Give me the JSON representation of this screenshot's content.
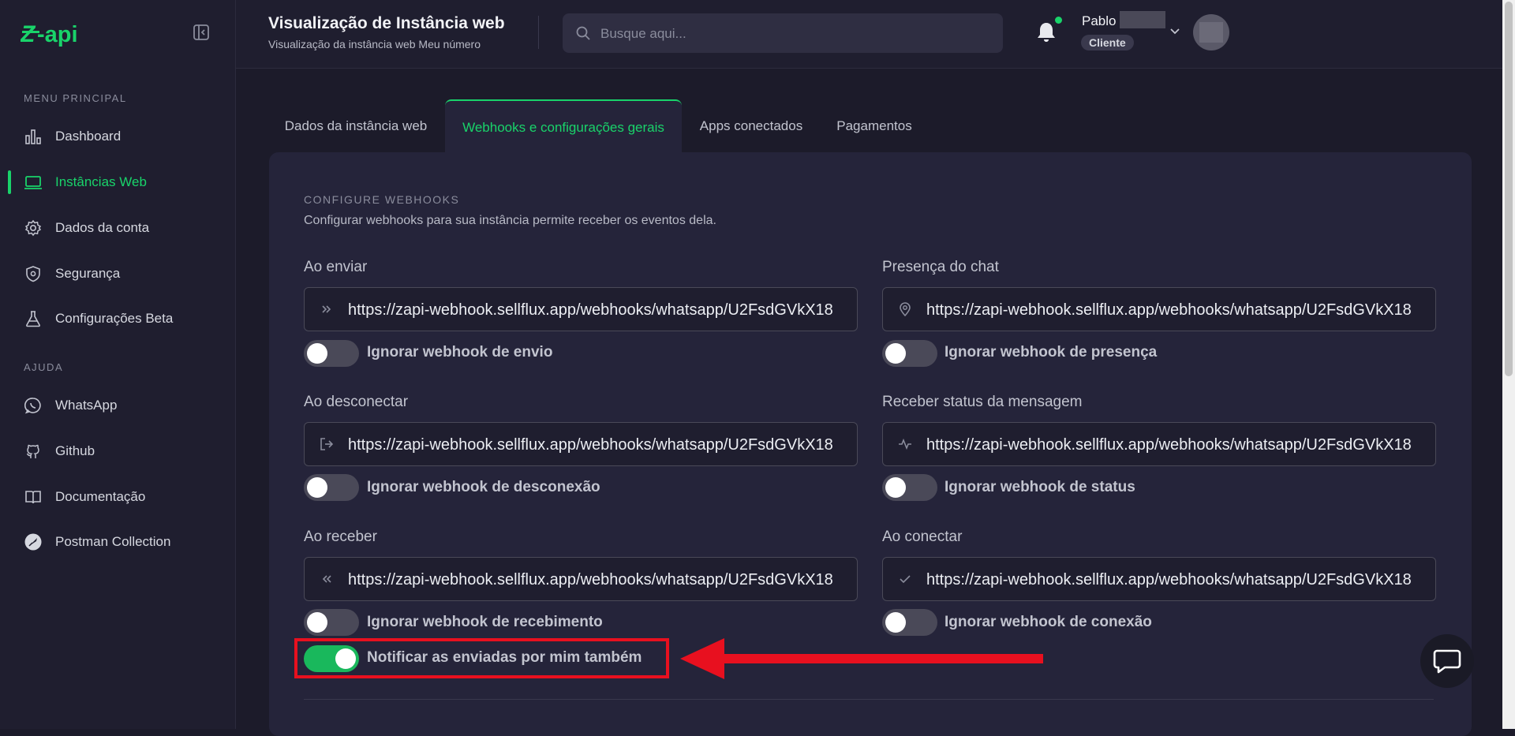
{
  "brand": {
    "logo_text": "Z-api",
    "accent": "#19d36a"
  },
  "sidebar": {
    "section_main": "MENU PRINCIPAL",
    "section_help": "AJUDA",
    "items": [
      {
        "label": "Dashboard",
        "icon": "bar-chart-icon"
      },
      {
        "label": "Instâncias Web",
        "icon": "laptop-icon",
        "active": true
      },
      {
        "label": "Dados da conta",
        "icon": "gear-icon"
      },
      {
        "label": "Segurança",
        "icon": "shield-icon"
      },
      {
        "label": "Configurações Beta",
        "icon": "flask-icon"
      }
    ],
    "help_items": [
      {
        "label": "WhatsApp",
        "icon": "whatsapp-icon"
      },
      {
        "label": "Github",
        "icon": "github-icon"
      },
      {
        "label": "Documentação",
        "icon": "book-icon"
      },
      {
        "label": "Postman Collection",
        "icon": "postman-icon"
      }
    ]
  },
  "header": {
    "title": "Visualização de Instância web",
    "subtitle": "Visualização da instância web Meu número",
    "search_placeholder": "Busque aqui...",
    "user_name": "Pablo",
    "user_role": "Cliente"
  },
  "tabs": [
    {
      "label": "Dados da instância web"
    },
    {
      "label": "Webhooks e configurações gerais",
      "active": true
    },
    {
      "label": "Apps conectados"
    },
    {
      "label": "Pagamentos"
    }
  ],
  "config": {
    "title": "CONFIGURE WEBHOOKS",
    "description": "Configurar webhooks para sua instância permite receber os eventos dela.",
    "fields": {
      "ao_enviar": {
        "label": "Ao enviar",
        "value": "https://zapi-webhook.sellflux.app/webhooks/whatsapp/U2FsdGVkX18",
        "icon": "double-chevron-right-icon",
        "toggle_label": "Ignorar webhook de envio",
        "toggle_on": false
      },
      "presenca": {
        "label": "Presença do chat",
        "value": "https://zapi-webhook.sellflux.app/webhooks/whatsapp/U2FsdGVkX18",
        "icon": "location-pin-icon",
        "toggle_label": "Ignorar webhook de presença",
        "toggle_on": false
      },
      "ao_desconectar": {
        "label": "Ao desconectar",
        "value": "https://zapi-webhook.sellflux.app/webhooks/whatsapp/U2FsdGVkX18",
        "icon": "logout-icon",
        "toggle_label": "Ignorar webhook de desconexão",
        "toggle_on": false
      },
      "status": {
        "label": "Receber status da mensagem",
        "value": "https://zapi-webhook.sellflux.app/webhooks/whatsapp/U2FsdGVkX18",
        "icon": "activity-icon",
        "toggle_label": "Ignorar webhook de status",
        "toggle_on": false
      },
      "ao_receber": {
        "label": "Ao receber",
        "value": "https://zapi-webhook.sellflux.app/webhooks/whatsapp/U2FsdGVkX18",
        "icon": "double-chevron-left-icon",
        "toggle_label": "Ignorar webhook de recebimento",
        "toggle_on": false
      },
      "ao_conectar": {
        "label": "Ao conectar",
        "value": "https://zapi-webhook.sellflux.app/webhooks/whatsapp/U2FsdGVkX18",
        "icon": "check-icon",
        "toggle_label": "Ignorar webhook de conexão",
        "toggle_on": false
      }
    },
    "notify_label": "Notificar as enviadas por mim também",
    "notify_on": true
  }
}
